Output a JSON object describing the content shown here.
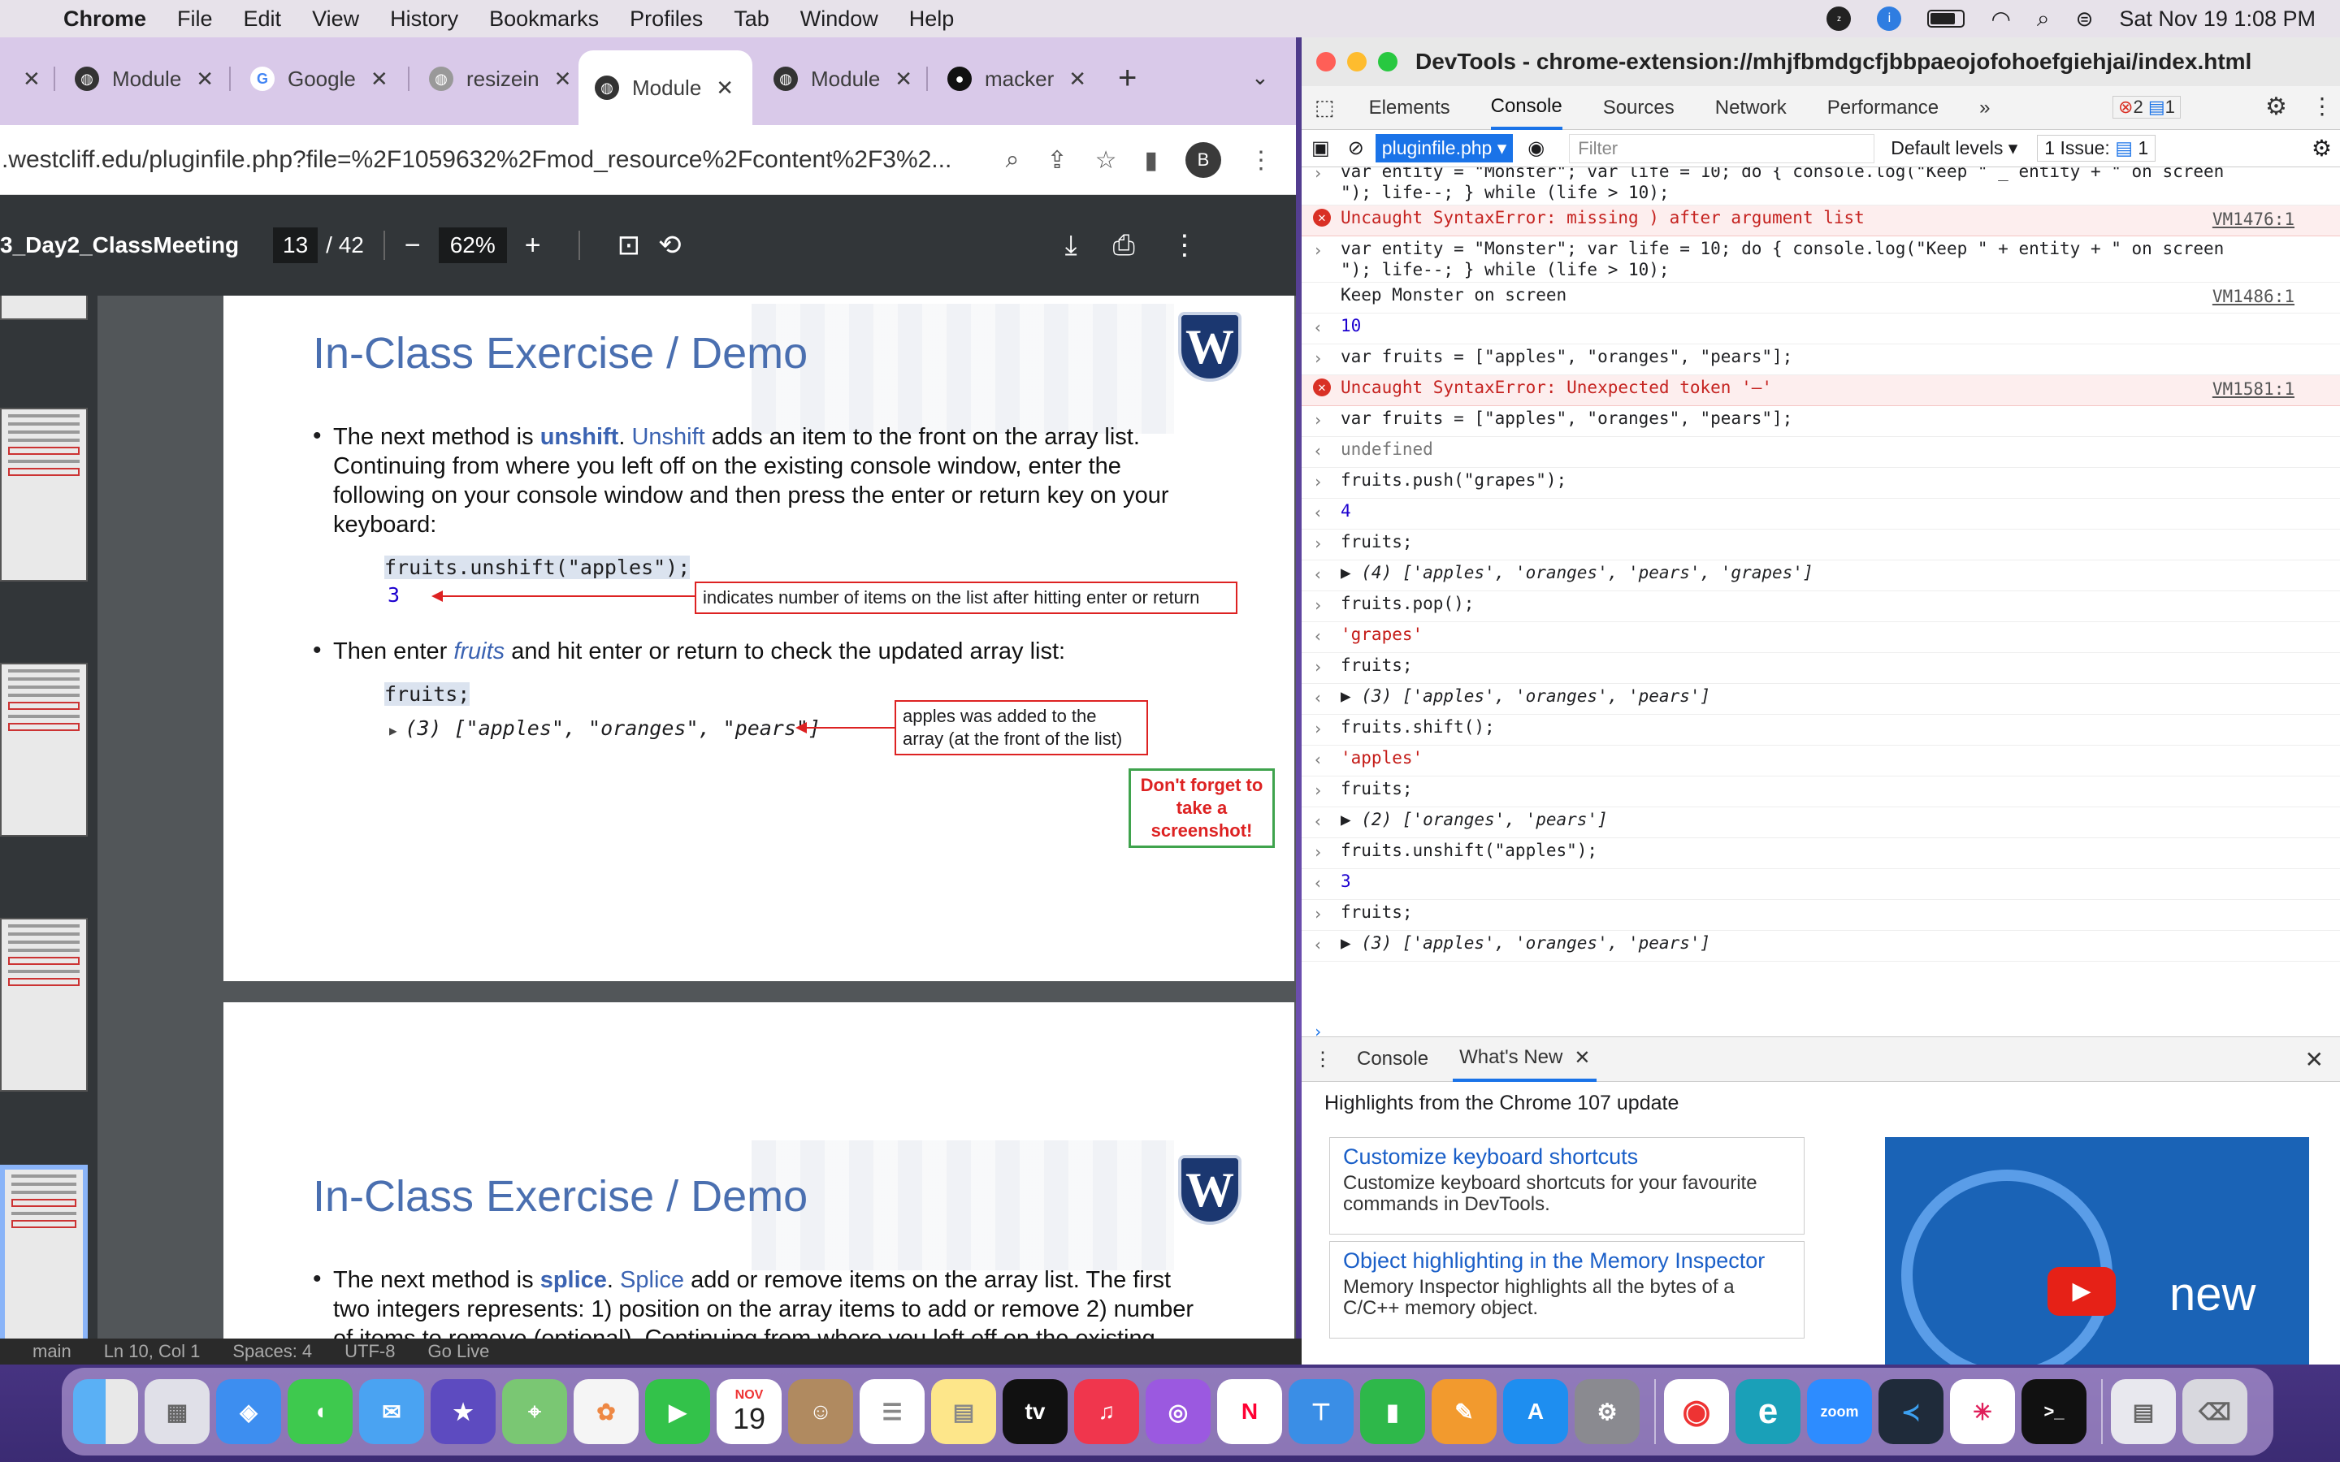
{
  "menubar": {
    "app": "Chrome",
    "items": [
      "File",
      "Edit",
      "View",
      "History",
      "Bookmarks",
      "Profiles",
      "Tab",
      "Window",
      "Help"
    ],
    "datetime": "Sat Nov 19  1:08 PM"
  },
  "chrome": {
    "tabs": [
      {
        "label": "Module",
        "icon": "moodle-icon"
      },
      {
        "label": "Google",
        "icon": "google-icon"
      },
      {
        "label": "resizein",
        "icon": "globe-icon"
      },
      {
        "label": "Module",
        "icon": "moodle-icon"
      },
      {
        "label": "Module",
        "icon": "moodle-icon"
      },
      {
        "label": "macker",
        "icon": "github-icon"
      }
    ],
    "url": ".westcliff.edu/pluginfile.php?file=%2F1059632%2Fmod_resource%2Fcontent%2F3%2...",
    "profile_initial": "B"
  },
  "pdf": {
    "doc_title": "3_Day2_ClassMeeting",
    "page_current": "13",
    "page_total": "/ 42",
    "zoom": "62%",
    "slide1": {
      "title": "In-Class Exercise / Demo",
      "bullet1_pre": "The next method is ",
      "bullet1_method": "unshift",
      "bullet1_dot": ". ",
      "bullet1_method2": "Unshift",
      "bullet1_post": " adds an item to the front on the array list. Continuing from where you left off on the existing console window, enter the following on your console window and then press the enter or return key on your keyboard:",
      "code1": "fruits.unshift(\"apples\");",
      "code1_result": "3",
      "callout1": "indicates number of items on the list after hitting enter or return",
      "bullet2_pre": "Then enter ",
      "bullet2_em": "fruits",
      "bullet2_post": " and hit enter or return to check the updated array list:",
      "code2": "fruits;",
      "code2_result": "(3) [\"apples\", \"oranges\", \"pears\"]",
      "callout2": "apples was added to the array (at the front of the list)",
      "reminder": "Don't forget to take a screenshot!"
    },
    "slide2": {
      "title": "In-Class Exercise / Demo",
      "bullet1_pre": "The next method is ",
      "bullet1_method": "splice",
      "bullet1_dot": ". ",
      "bullet1_method2": "Splice",
      "bullet1_post": " add or remove items on the array list. The first two integers represents: 1) position on the array items to add or remove 2) number of items to remove (optional). Continuing from where you left off on the existing console window, enter the following on your console window and then"
    }
  },
  "devtools": {
    "title": "DevTools - chrome-extension://mhjfbmdgcfjbbpaeojofohoefgiehjai/index.html",
    "tabs": [
      "Elements",
      "Console",
      "Sources",
      "Network",
      "Performance"
    ],
    "error_count": "2",
    "msg_count": "1",
    "context": "pluginfile.php",
    "filter_placeholder": "Filter",
    "levels": "Default levels",
    "issues": "1 Issue:",
    "issues_count": "1",
    "console": [
      {
        "type": "input",
        "text": "var entity = \"Monster\"; var life = 10; do { console.log(\"Keep \" _ entity + \" on screen\n\"); life--; } while (life > 10);"
      },
      {
        "type": "error",
        "text": "Uncaught SyntaxError: missing ) after argument list",
        "src": "VM1476:1"
      },
      {
        "type": "input",
        "text": "var entity = \"Monster\"; var life = 10; do { console.log(\"Keep \" + entity + \" on screen\n\"); life--; } while (life > 10);"
      },
      {
        "type": "log",
        "text": "Keep Monster on screen",
        "src": "VM1486:1"
      },
      {
        "type": "result",
        "text": "10"
      },
      {
        "type": "input",
        "text": "var fruits = [\"apples\", \"oranges\", \"pears\"];"
      },
      {
        "type": "error",
        "text": "Uncaught SyntaxError: Unexpected token '–'",
        "src": "VM1581:1"
      },
      {
        "type": "input",
        "text": "var fruits = [\"apples\", \"oranges\", \"pears\"];"
      },
      {
        "type": "result",
        "text": "undefined"
      },
      {
        "type": "input",
        "text": "fruits.push(\"grapes\");"
      },
      {
        "type": "result",
        "text": "4"
      },
      {
        "type": "input",
        "text": "fruits;"
      },
      {
        "type": "result",
        "text": "▶ (4) ['apples', 'oranges', 'pears', 'grapes']"
      },
      {
        "type": "input",
        "text": "fruits.pop();"
      },
      {
        "type": "result",
        "text": "'grapes'"
      },
      {
        "type": "input",
        "text": "fruits;"
      },
      {
        "type": "result",
        "text": "▶ (3) ['apples', 'oranges', 'pears']"
      },
      {
        "type": "input",
        "text": "fruits.shift();"
      },
      {
        "type": "result",
        "text": "'apples'"
      },
      {
        "type": "input",
        "text": "fruits;"
      },
      {
        "type": "result",
        "text": "▶ (2) ['oranges', 'pears']"
      },
      {
        "type": "input",
        "text": "fruits.unshift(\"apples\");"
      },
      {
        "type": "result",
        "text": "3"
      },
      {
        "type": "input",
        "text": "fruits;"
      },
      {
        "type": "result",
        "text": "▶ (3) ['apples', 'oranges', 'pears']"
      }
    ],
    "drawer_tabs": [
      "Console",
      "What's New"
    ],
    "drawer_heading": "Highlights from the Chrome 107 update",
    "cards": [
      {
        "title": "Customize keyboard shortcuts",
        "desc": "Customize keyboard shortcuts for your favourite commands in DevTools."
      },
      {
        "title": "Object highlighting in the Memory Inspector",
        "desc": "Memory Inspector highlights all the bytes of a C/C++ memory object."
      }
    ],
    "video_text": "new"
  },
  "vscode_fragment": [
    "main",
    "Ln 10, Col 1",
    "Spaces: 4",
    "UTF-8",
    "Go Live"
  ],
  "dock": {
    "calendar_month": "NOV",
    "calendar_day": "19",
    "apps": [
      "finder-icon",
      "launchpad-icon",
      "safari-icon",
      "messages-icon",
      "mail-icon",
      "imovie-icon",
      "maps-icon",
      "photos-icon",
      "facetime-icon",
      "contacts-icon",
      "calendar-icon",
      "reminders-icon",
      "notes-icon",
      "tv-icon",
      "music-icon",
      "podcasts-icon",
      "news-icon",
      "keynote-icon",
      "numbers-icon",
      "pages-icon",
      "app-store-icon",
      "system-settings-icon",
      "chrome-icon",
      "edge-icon",
      "zoom-icon",
      "vscode-icon",
      "slack-icon",
      "terminal-icon",
      "downloads-icon",
      "trash-icon"
    ],
    "tv_label": "tv",
    "zoom_label": "zoom"
  }
}
